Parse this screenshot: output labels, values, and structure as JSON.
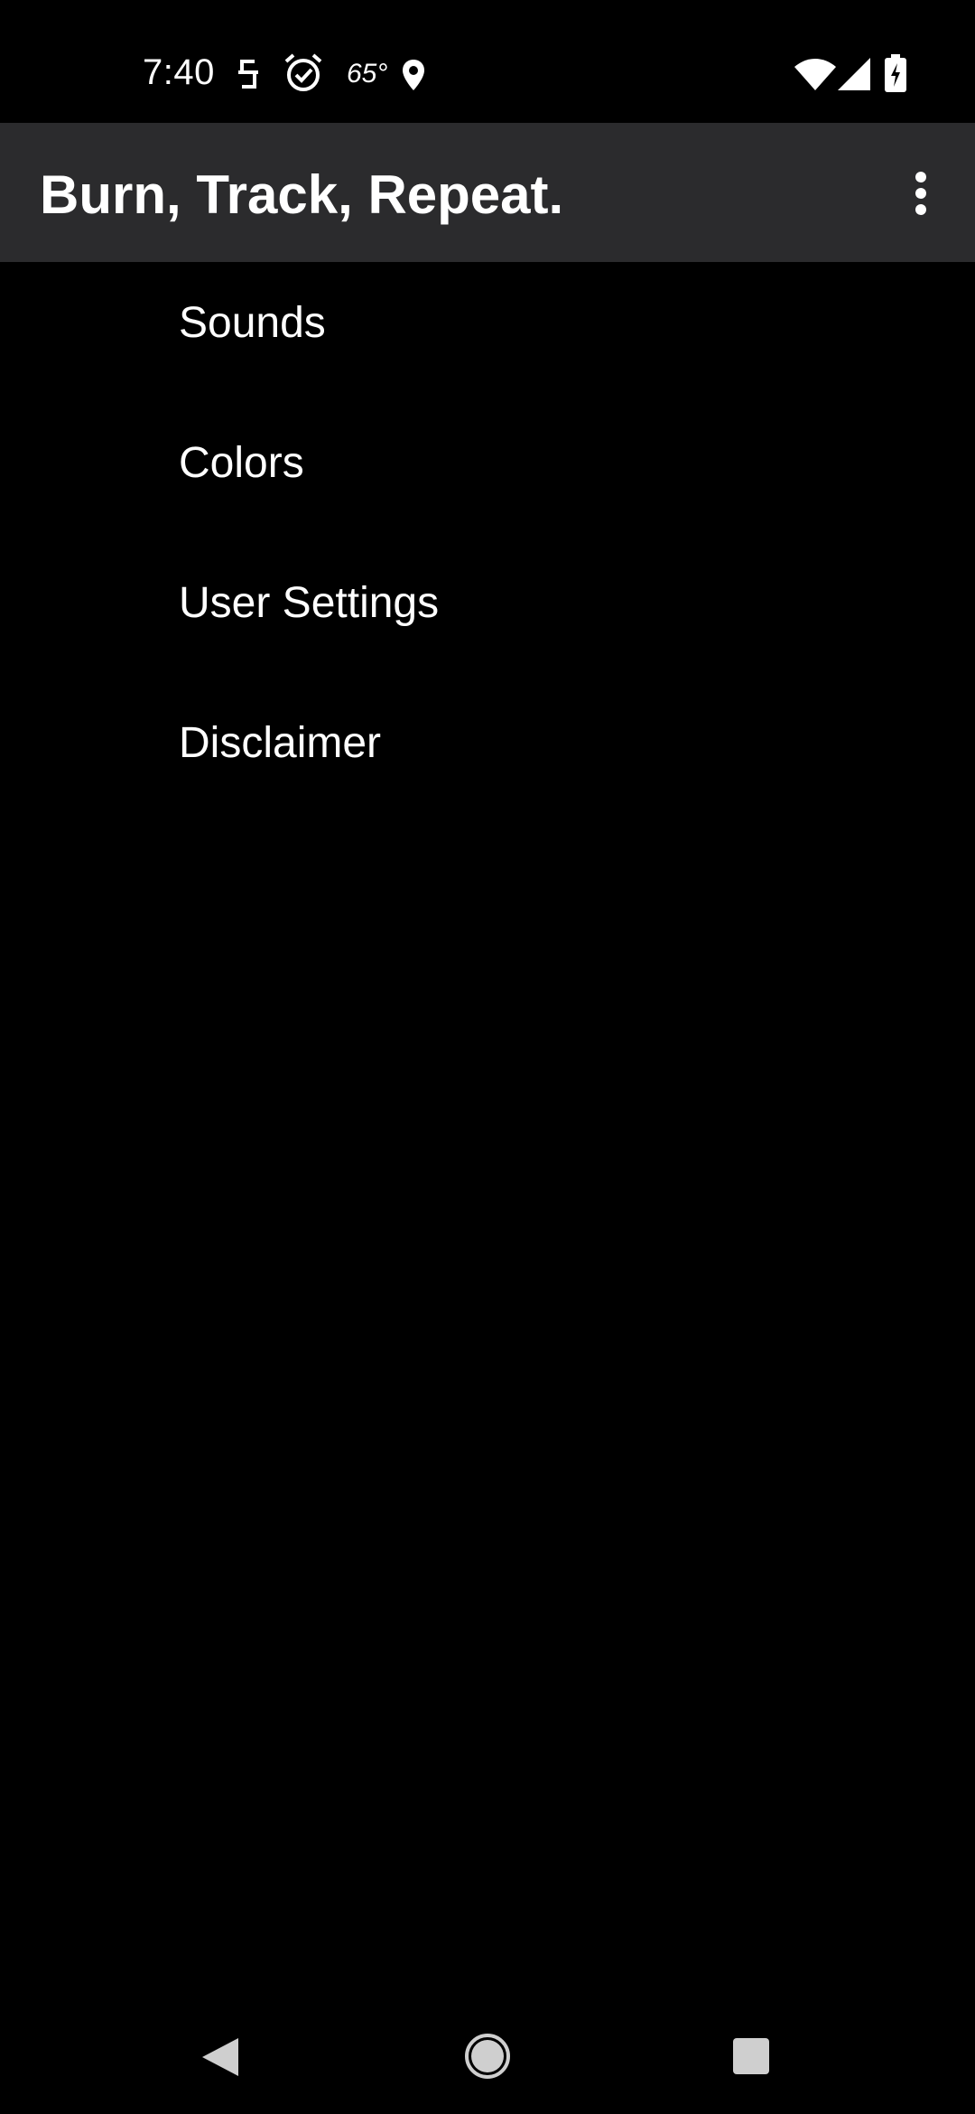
{
  "status_bar": {
    "time": "7:40",
    "temperature": "65°",
    "icons": [
      "s-notification-icon",
      "alarm-icon",
      "location-icon",
      "wifi-icon",
      "cell-signal-icon",
      "battery-charging-icon"
    ]
  },
  "app_bar": {
    "title": "Burn, Track, Repeat.",
    "overflow_icon": "more-vert-icon",
    "background": "#2b2b2d"
  },
  "menu": {
    "items": [
      {
        "label": "Sounds"
      },
      {
        "label": "Colors"
      },
      {
        "label": "User Settings"
      },
      {
        "label": "Disclaimer"
      }
    ]
  },
  "nav_bar": {
    "icons": [
      "back-icon",
      "home-icon",
      "recents-icon"
    ]
  },
  "colors": {
    "background": "#000000",
    "text": "#ffffff",
    "nav_icon": "#cfcfcf"
  }
}
